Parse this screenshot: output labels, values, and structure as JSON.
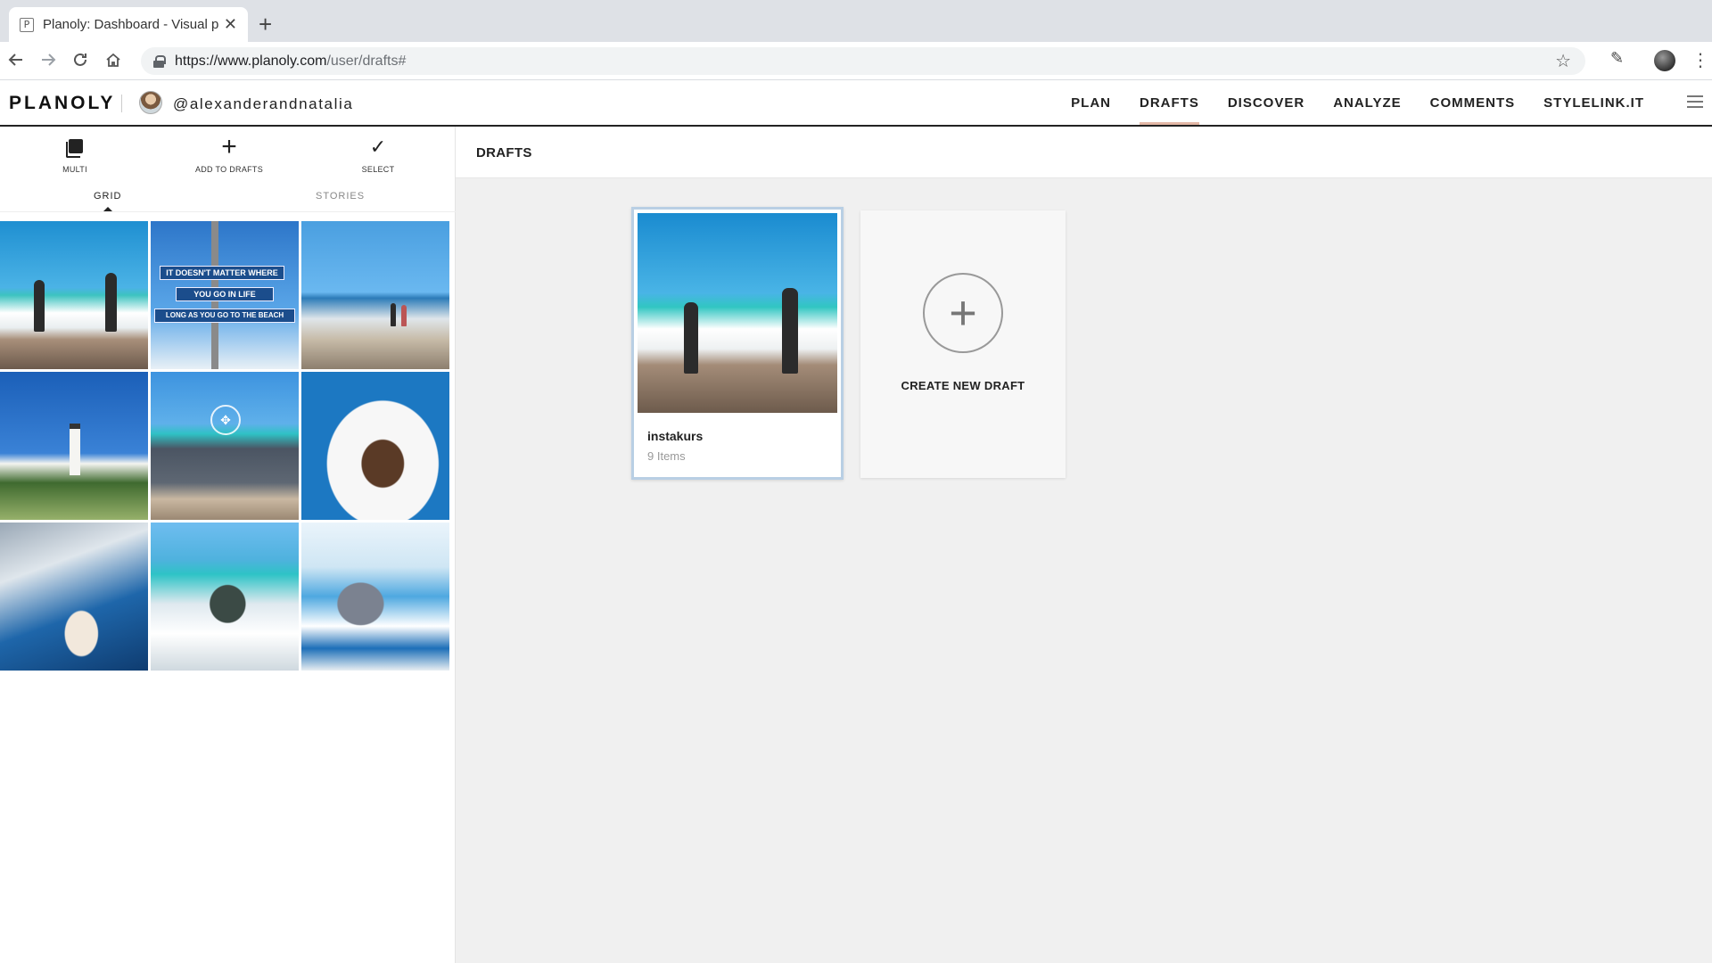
{
  "browser": {
    "tab_title": "Planoly: Dashboard - Visual pl",
    "tab_favicon": "P",
    "close_glyph": "✕",
    "newtab_glyph": "+",
    "url_main": "https://www.planoly.com",
    "url_path": "/user/drafts#",
    "icons": [
      "back-arrow-icon",
      "forward-arrow-icon",
      "reload-icon",
      "home-icon",
      "lock-icon",
      "star-icon",
      "extension-icon",
      "profile-icon",
      "kebab-menu-icon"
    ]
  },
  "header": {
    "logo": "PLANOLY",
    "username": "@alexanderandnatalia",
    "nav": [
      "PLAN",
      "DRAFTS",
      "DISCOVER",
      "ANALYZE",
      "COMMENTS",
      "STYLELINK.IT"
    ],
    "active_nav": "DRAFTS",
    "accent_color": "#e3b8a6"
  },
  "sidebar": {
    "tools": [
      {
        "label": "MULTI",
        "icon": "multi-icon"
      },
      {
        "label": "ADD TO DRAFTS",
        "icon": "plus-icon"
      },
      {
        "label": "SELECT",
        "icon": "check-icon"
      }
    ],
    "tabs": [
      "GRID",
      "STORIES"
    ],
    "active_tab": "GRID",
    "sign_lines": [
      "IT DOESN'T MATTER WHERE",
      "YOU GO IN LIFE",
      "LONG AS YOU GO TO THE BEACH"
    ]
  },
  "main": {
    "title": "DRAFTS",
    "draft": {
      "name": "instakurs",
      "count": "9 Items"
    },
    "create_label": "CREATE NEW DRAFT"
  }
}
